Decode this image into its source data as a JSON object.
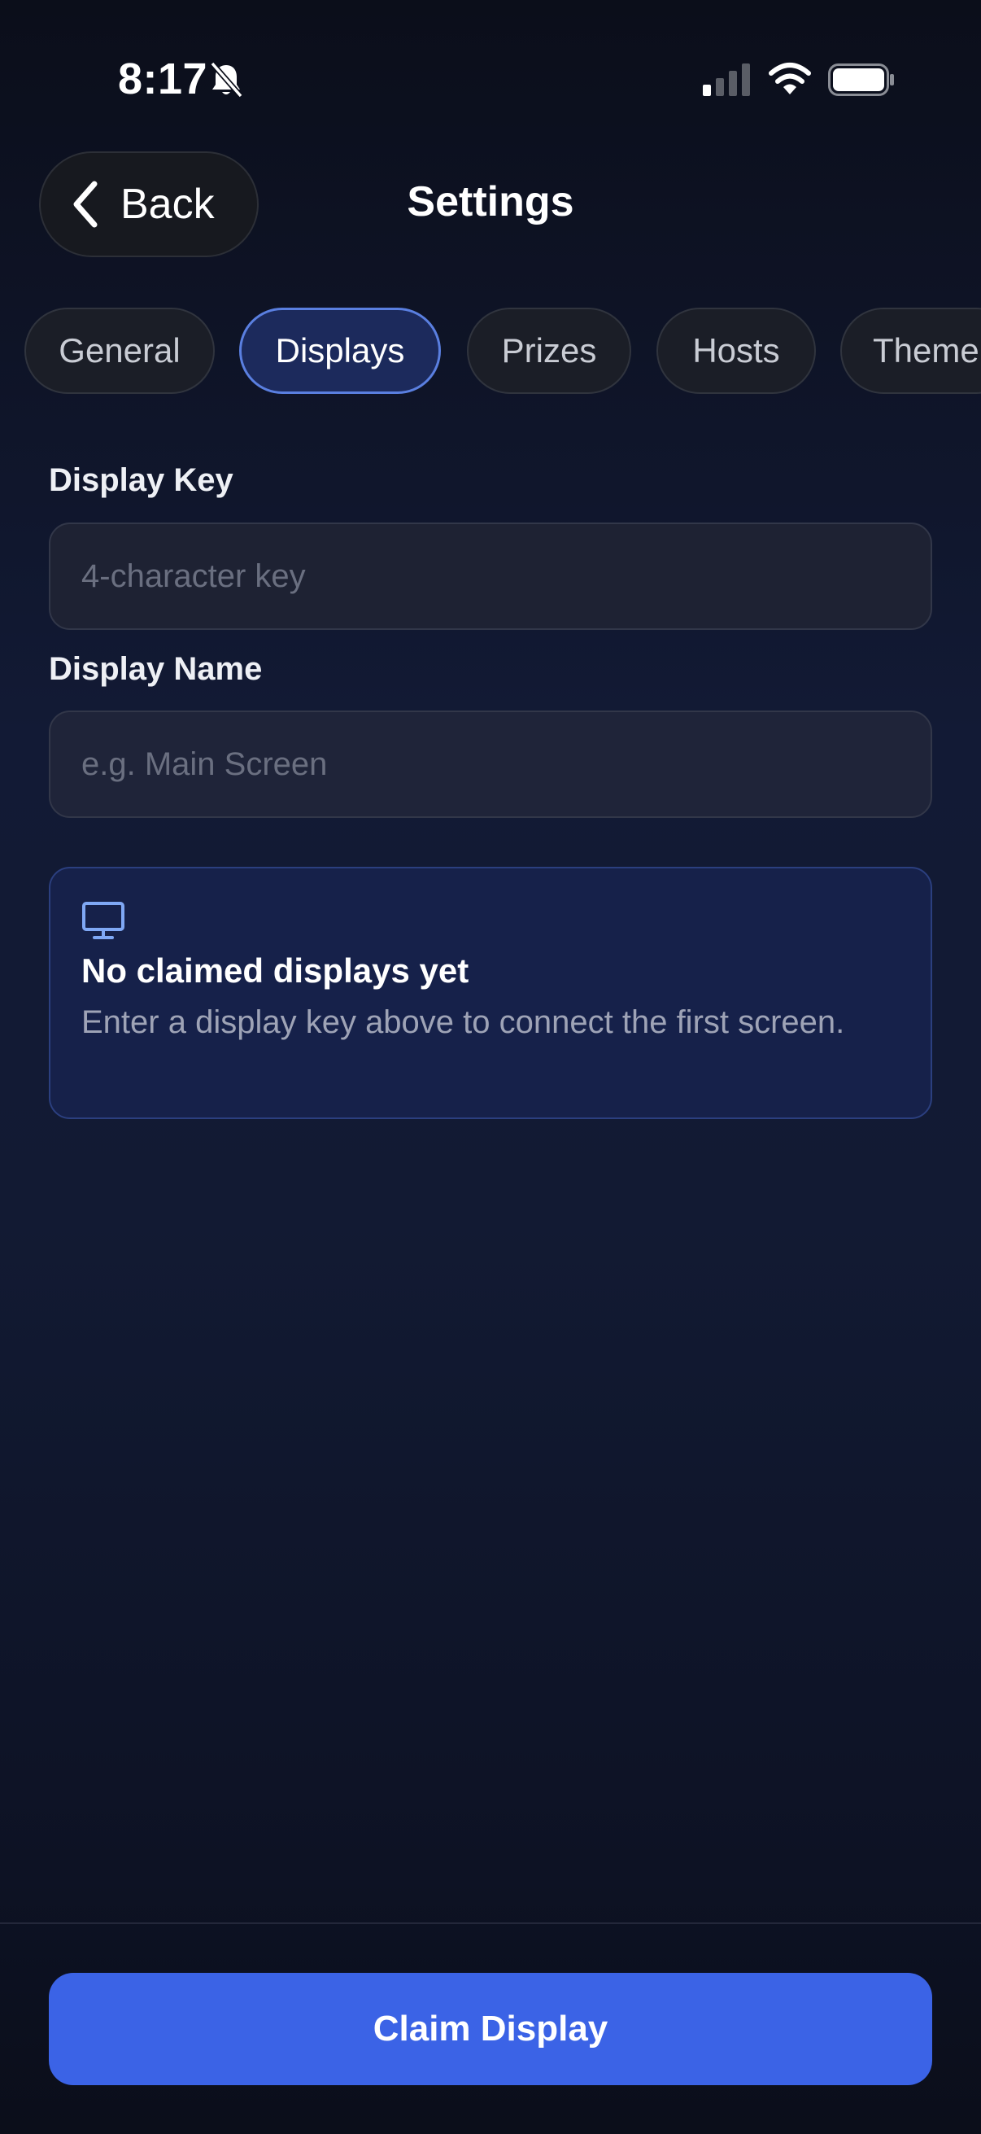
{
  "status_bar": {
    "time": "8:17",
    "icons": [
      "bell-slash-icon",
      "cellular-signal-icon",
      "wifi-icon",
      "battery-icon"
    ]
  },
  "header": {
    "back_label": "Back",
    "title": "Settings"
  },
  "tabs": [
    {
      "label": "General",
      "active": false
    },
    {
      "label": "Displays",
      "active": true
    },
    {
      "label": "Prizes",
      "active": false
    },
    {
      "label": "Hosts",
      "active": false
    },
    {
      "label": "Theme",
      "active": false
    }
  ],
  "form": {
    "display_key": {
      "label": "Display Key",
      "placeholder": "4-character key",
      "value": ""
    },
    "display_name": {
      "label": "Display Name",
      "placeholder": "e.g. Main Screen",
      "value": ""
    }
  },
  "empty_state": {
    "icon": "monitor-icon",
    "title": "No claimed displays yet",
    "description": "Enter a display key above to connect the first screen."
  },
  "footer": {
    "claim_label": "Claim Display"
  },
  "colors": {
    "accent": "#3b63e6",
    "active_tab_bg": "#1c2a5c",
    "active_tab_border": "#5a7fe0",
    "card_bg": "#16214a",
    "icon_blue": "#7fa8f5"
  }
}
